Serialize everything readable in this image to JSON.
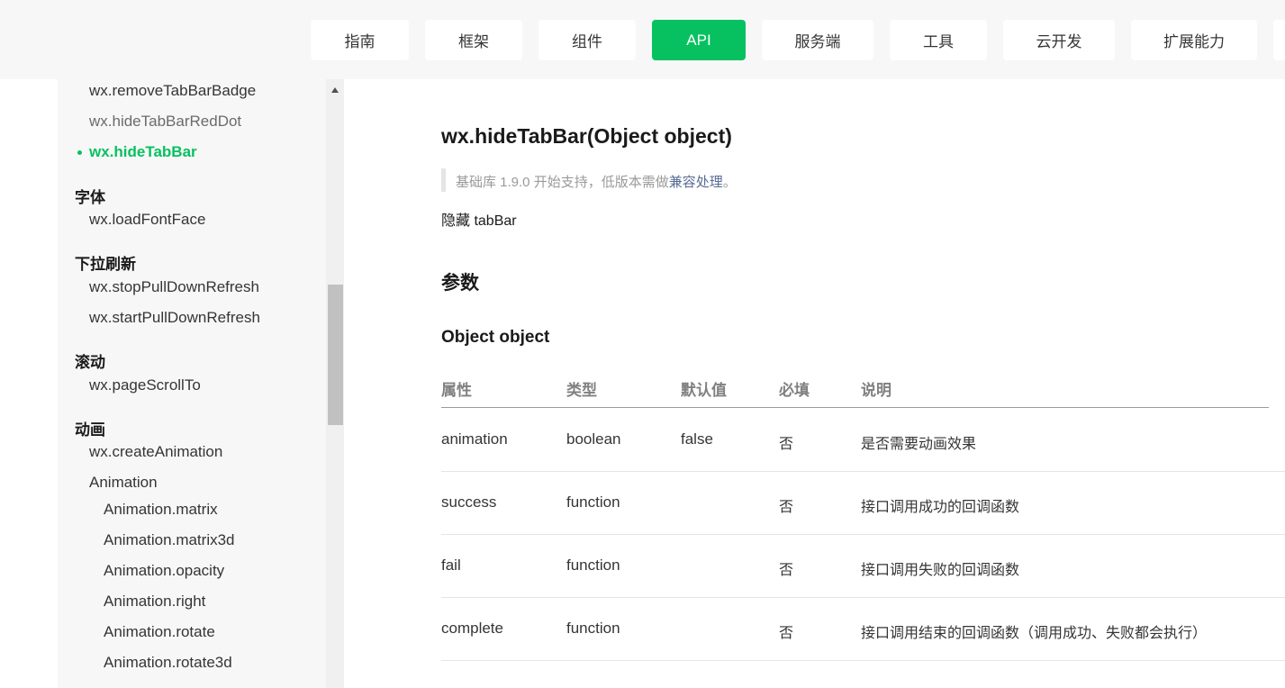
{
  "nav": {
    "items": [
      {
        "label": "指南",
        "active": false
      },
      {
        "label": "框架",
        "active": false
      },
      {
        "label": "组件",
        "active": false
      },
      {
        "label": "API",
        "active": true
      },
      {
        "label": "服务端",
        "active": false
      },
      {
        "label": "工具",
        "active": false
      },
      {
        "label": "云开发",
        "active": false
      },
      {
        "label": "扩展能力",
        "active": false
      }
    ]
  },
  "sidebar": {
    "items": [
      {
        "label": "wx.removeTabBarBadge",
        "type": "item"
      },
      {
        "label": "wx.hideTabBarRedDot",
        "type": "item"
      },
      {
        "label": "wx.hideTabBar",
        "type": "active"
      },
      {
        "label": "字体",
        "type": "category"
      },
      {
        "label": "wx.loadFontFace",
        "type": "item"
      },
      {
        "label": "下拉刷新",
        "type": "category"
      },
      {
        "label": "wx.stopPullDownRefresh",
        "type": "item"
      },
      {
        "label": "wx.startPullDownRefresh",
        "type": "item"
      },
      {
        "label": "滚动",
        "type": "category"
      },
      {
        "label": "wx.pageScrollTo",
        "type": "item"
      },
      {
        "label": "动画",
        "type": "category"
      },
      {
        "label": "wx.createAnimation",
        "type": "item"
      },
      {
        "label": "Animation",
        "type": "item"
      },
      {
        "label": "Animation.matrix",
        "type": "subitem"
      },
      {
        "label": "Animation.matrix3d",
        "type": "subitem"
      },
      {
        "label": "Animation.opacity",
        "type": "subitem"
      },
      {
        "label": "Animation.right",
        "type": "subitem"
      },
      {
        "label": "Animation.rotate",
        "type": "subitem"
      },
      {
        "label": "Animation.rotate3d",
        "type": "subitem"
      }
    ]
  },
  "content": {
    "title": "wx.hideTabBar(Object object)",
    "support_prefix": "基础库 1.9.0 开始支持，低版本需做",
    "support_link": "兼容处理",
    "support_suffix": "。",
    "description": "隐藏 tabBar",
    "params_heading": "参数",
    "object_heading": "Object object",
    "table": {
      "headers": [
        "属性",
        "类型",
        "默认值",
        "必填",
        "说明"
      ],
      "rows": [
        [
          "animation",
          "boolean",
          "false",
          "否",
          "是否需要动画效果"
        ],
        [
          "success",
          "function",
          "",
          "否",
          "接口调用成功的回调函数"
        ],
        [
          "fail",
          "function",
          "",
          "否",
          "接口调用失败的回调函数"
        ],
        [
          "complete",
          "function",
          "",
          "否",
          "接口调用结束的回调函数（调用成功、失败都会执行）"
        ]
      ]
    }
  },
  "colors": {
    "accent": "#07c160",
    "link": "#576b95",
    "nav_bg": "#f7f7f7",
    "sidebar_bg": "#f7f7f7"
  }
}
